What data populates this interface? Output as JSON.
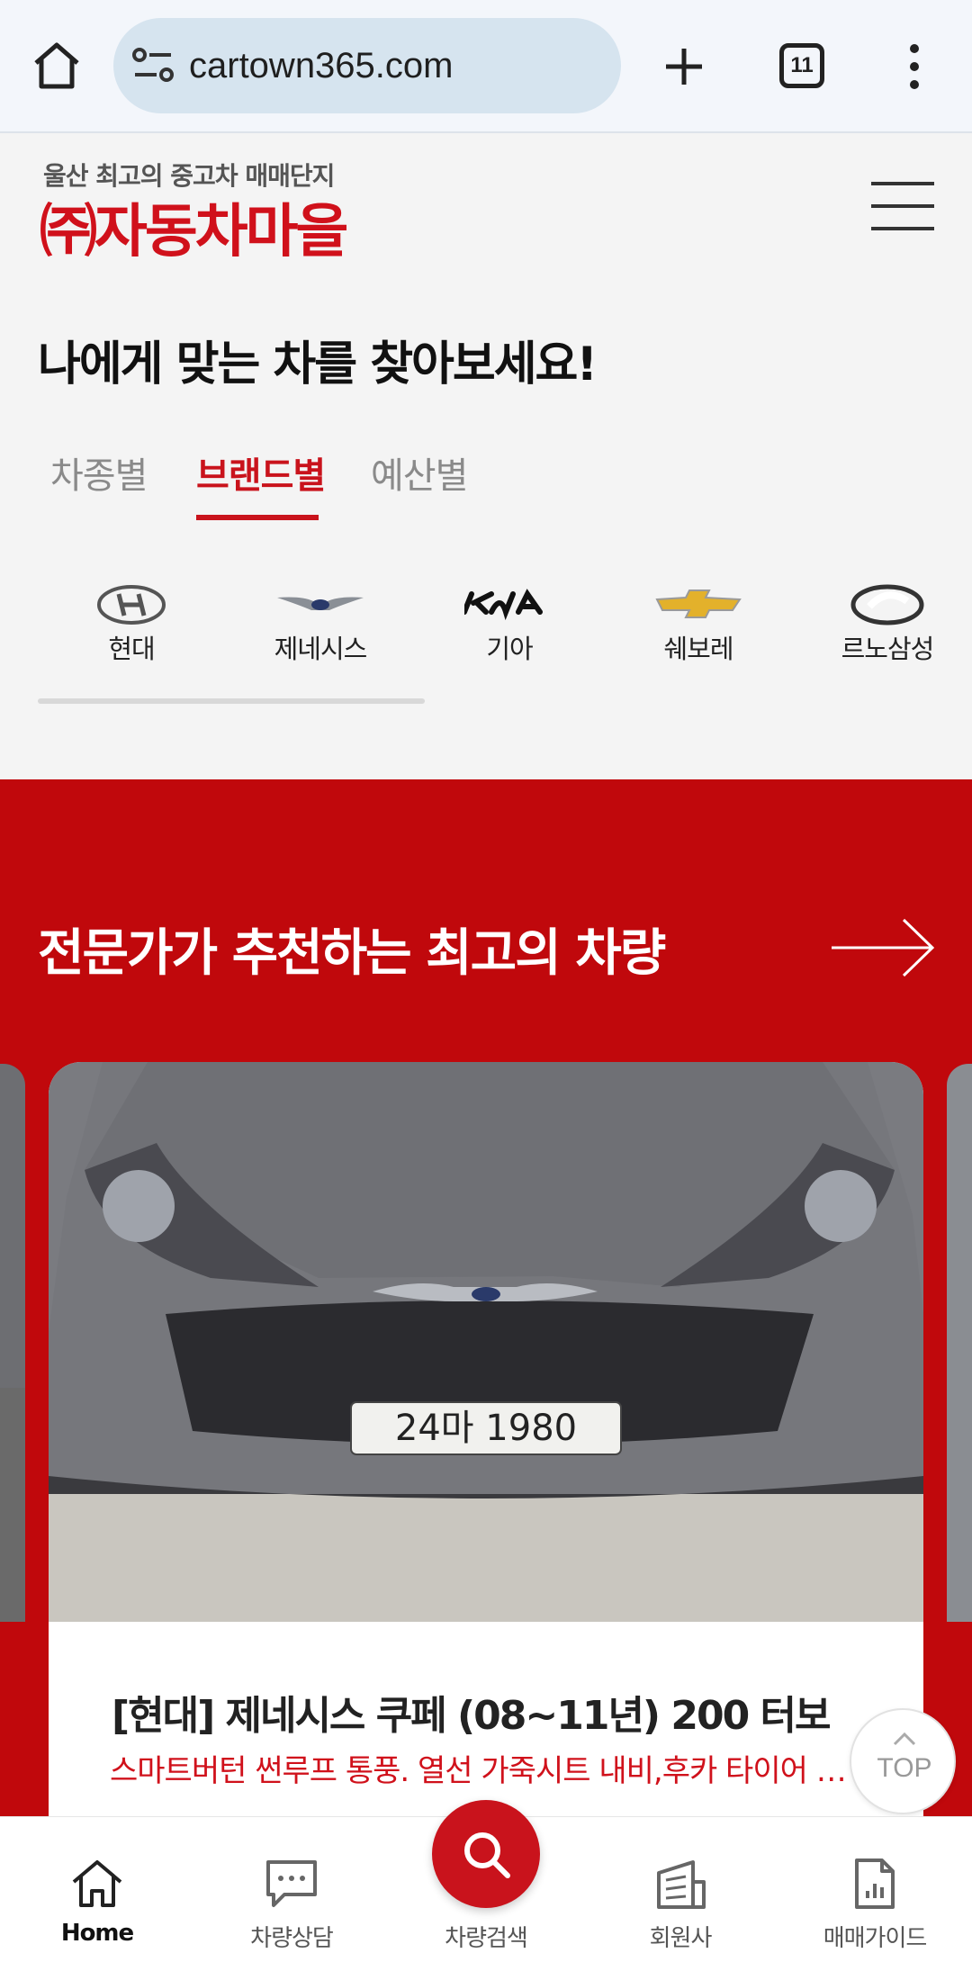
{
  "browser": {
    "url": "cartown365.com",
    "tab_count": "11"
  },
  "header": {
    "tagline": "울산 최고의 중고차 매매단지",
    "logo_text": "㈜자동차마을"
  },
  "finder": {
    "title": "나에게 맞는 차를 찾아보세요!",
    "tabs": [
      "차종별",
      "브랜드별",
      "예산별"
    ],
    "active_tab": "브랜드별",
    "brands": [
      {
        "label": "현대",
        "icon": "hyundai-logo"
      },
      {
        "label": "제네시스",
        "icon": "genesis-logo"
      },
      {
        "label": "기아",
        "icon": "kia-logo"
      },
      {
        "label": "쉐보레",
        "icon": "chevrolet-logo"
      },
      {
        "label": "르노삼성",
        "icon": "renault-samsung-logo"
      }
    ]
  },
  "recommend": {
    "title": "전문가가 추천하는 최고의 차량",
    "card": {
      "plate": "24마 1980",
      "title": "[현대] 제네시스 쿠페 (08~11년) 200 터보",
      "desc": "스마트버턴 썬루프 통풍. 열선 가죽시트 내비,후카 타이어 교체"
    }
  },
  "top_button": "TOP",
  "bottom_nav": [
    {
      "label": "Home",
      "icon": "home-icon"
    },
    {
      "label": "차량상담",
      "icon": "chat-icon"
    },
    {
      "label": "차량검색",
      "icon": "search-icon"
    },
    {
      "label": "회원사",
      "icon": "building-icon"
    },
    {
      "label": "매매가이드",
      "icon": "guide-icon"
    }
  ],
  "colors": {
    "accent": "#c9131c",
    "band": "#c0080c",
    "browser_bg": "#f3f6fb",
    "url_pill": "#d6e4ef"
  }
}
